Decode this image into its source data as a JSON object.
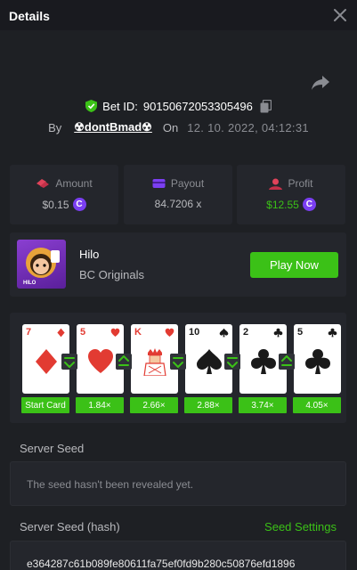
{
  "header": {
    "title": "Details"
  },
  "bet": {
    "id_label": "Bet ID:",
    "id": "90150672053305496",
    "by_label": "By",
    "username": "☢dontBmad☢",
    "on_label": "On",
    "datetime": "12. 10. 2022, 04:12:31"
  },
  "stats": {
    "amount": {
      "label": "Amount",
      "value": "$0.15",
      "icon": "coins-icon"
    },
    "payout": {
      "label": "Payout",
      "value": "84.7206 x",
      "icon": "wallet-icon"
    },
    "profit": {
      "label": "Profit",
      "value": "$12.55",
      "icon": "profit-icon"
    }
  },
  "currency_symbol": "C",
  "game": {
    "name": "Hilo",
    "provider": "BC Originals",
    "play_label": "Play Now",
    "thumb_label": "HILO"
  },
  "cards": [
    {
      "rank": "7",
      "suit": "diamond",
      "color": "red",
      "multiplier": "Start Card"
    },
    {
      "rank": "5",
      "suit": "heart",
      "color": "red",
      "multiplier": "1.84×"
    },
    {
      "rank": "K",
      "suit": "heart",
      "color": "red",
      "multiplier": "2.66×"
    },
    {
      "rank": "10",
      "suit": "spade",
      "color": "black",
      "multiplier": "2.88×"
    },
    {
      "rank": "2",
      "suit": "club",
      "color": "black",
      "multiplier": "3.74×"
    },
    {
      "rank": "5",
      "suit": "club",
      "color": "black",
      "multiplier": "4.05×"
    }
  ],
  "guesses": [
    "lower",
    "higher",
    "lower",
    "lower",
    "higher"
  ],
  "server_seed": {
    "label": "Server Seed",
    "value": "The seed hasn't been revealed yet."
  },
  "server_seed_hash": {
    "label": "Server Seed (hash)",
    "settings_label": "Seed Settings",
    "value": "e364287c61b089fe80611fa75ef0fd9b280c50876efd1896"
  },
  "colors": {
    "accent": "#3bc117",
    "background": "#1e2024",
    "panel": "#24262c",
    "coin": "#7b3ff2",
    "card_red": "#e23b32"
  }
}
